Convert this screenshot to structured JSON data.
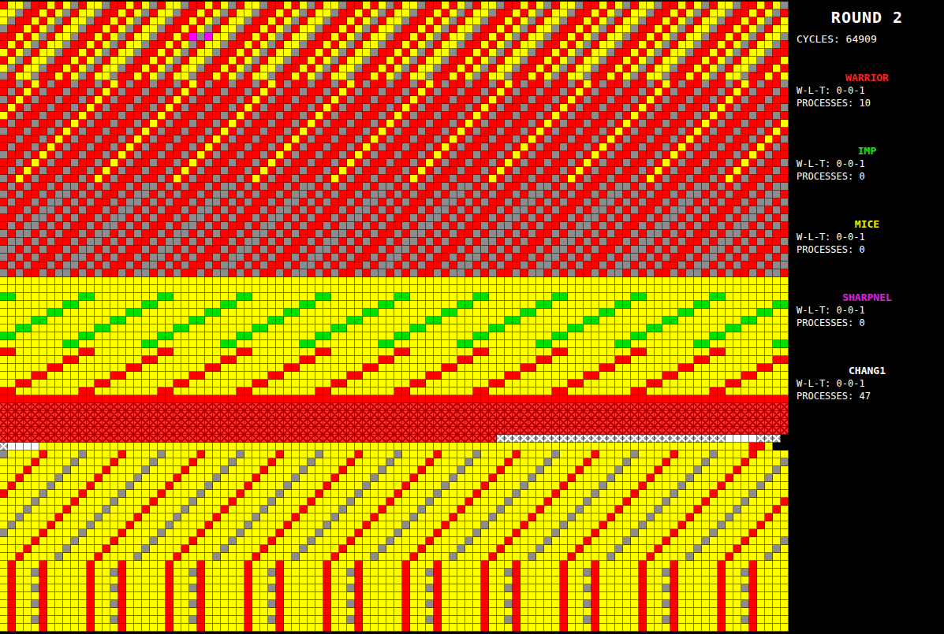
{
  "sidebar": {
    "round": "ROUND 2",
    "cycles": "CYCLES: 64909"
  },
  "warriors": [
    {
      "name": "WARRIOR",
      "record": "W-L-T: 0-0-1",
      "processes": "PROCESSES: 10",
      "color": "#ff2020"
    },
    {
      "name": "IMP",
      "record": "W-L-T: 0-0-1",
      "processes": "PROCESSES: 0",
      "color": "#20e020"
    },
    {
      "name": "MICE",
      "record": "W-L-T: 0-0-1",
      "processes": "PROCESSES: 0",
      "color": "#f0f000"
    },
    {
      "name": "SHARPNEL",
      "record": "W-L-T: 0-0-1",
      "processes": "PROCESSES: 0",
      "color": "#e020e0"
    },
    {
      "name": "CHANG1",
      "record": "W-L-T: 0-0-1",
      "processes": "PROCESSES: 47",
      "color": "#ffffff"
    }
  ],
  "core": {
    "rows": [
      "ryygrryrygryygrryrygryygrryrygryygrryrygryygrryrygryygrryrygryygrryrygryygrryrygryygrryrygryygrryryg",
      "yygrryrygryygrryrygryygrryrygryygrryrygryygrryrygryygrryrygryygrryrygryygrryrygryygrryrygryygrryrygr",
      "ygrryrygryygrryrygryygrryrygryygrryrygryygrryrygryygrryrygryygrryrygryygrryrygryygrryrygryygrryrygry",
      "grryrygryygrryrygryygrryrygryygrryrygryygrryrygryygrryrygryygrryrygryygrryrygryygrryrygryygrryrygryy",
      "rryrygryygrryrygryygrryrmgmyygrryrygryygrryrygryygrryrygryygrryrygryygrryrygryygrryrygryygrryrygryyg",
      "ryrygryygrryrygryygrryrygryygrryrygryygrryrygryygrryrygryygrryrygryygrryrygryygrryrygryygrryrygryygr",
      "yrygryygrryrygryygrryrygryygrryrygryygrryrygryygrryrygryygrryrygryygrryrygryygrryrygryygrryrygryygrr",
      "rygryygrryrygryygrryrygryygrryrygryygrryrygryygrryrygryygrryrygryygrryrygryygrryrygryygrryrygryygrry",
      "ygryygrryrygryygrryrygryygrryrygryygrryrygryygrryrygryygrryrygryygrryrygryygrryrygryygrryrygryygrryr",
      "gryygrryrygryygrryrygryygrryrygryygrryrygryygrryrygryygrryrygryygrryrygryygrryrygryygrryrygryygrryry",
      "rrgryrgrrgrrgryrgrrgrrgryrgrrgrrgryrgrrgrrgryrgrrgrrgryrgrrgrrgryrgrrgrrgryrgrrgrrgryrgrrgrrgryrgrrg",
      "rgryrgrrgrrgryrgrrgrrgryrgrrgrrgryrgrrgrrgryrgrrgrrgryrgrrgrrgryrgrrgrrgryrgrrgrrgryrgrrgrrgryrgrrgr",
      "gryrgrrgrrgryrgrrgrrgryrgrrgrrgryrgrrgrrgryrgrrgrrgryrgrrgrrgryrgrrgrrgryrgrrgrrgryrgrrgrrgryrgrrgrr",
      "ryrgrrgrrgryrgrrgrrgryrgrrgrrgryrgrrgrrgryrgrrgrrgryrgrrgrrgryrgrrgrrgryrgrrgrrgryrgrrgrrgryrgrrgrrg",
      "yrgrrgrrgryrgrrgrrgryrgrrgrrgryrgrrgrrgryrgrrgrrgryrgrrgrrgryrgrrgrrgryrgrrgrrgryrgrrgrrgryrgrrgrrgr",
      "rgrrgrrgryrgrrgrrgryrgrrgrrgryrgrrgrrgryrgrrgrrgryrgrrgrrgryrgrrgrrgryrgrrgrrgryrgrrgrrgryrgrrgrrgry",
      "grrgrrgryrgrrgrrgryrgrrgrrgryrgrrgrrgryrgrrgrrgryrgrrgrrgryrgrrgrrgryrgrrgrrgryrgrrgrrgryrgrrgrrgryr",
      "rrgrrgryrgrrgrrgryrgrrgrrgryrgrrgrrgryrgrrgrrgryrgrrgrrgryrgrrgrrgryrgrrgrrgryrgrrgrrgryrgrrgrrgryrg",
      "rgrrgryrgrrgrrgryrgrrgrrgryrgrrgrrgryrgrrgrrgryrgrrgrrgryrgrrgrrgryrgrrgrrgryrgrrgrrgryrgrrgrrgryrgr",
      "grrgryrgrrgrrgryrgrrgrrgryrgrrgrrgryrgrrgrrgryrgrrgrrgryrgrrgrrgryrgrrgrrgryrgrrgrrgryrgrrgrrgryrgrr",
      "rrgryrgrrgrrgryrgrrgrrgryrgrrgrrgryrgrrgrrgryrgrrgrrgryrgrrgrrgryrgrrgrrgryrgrrgrrgryrgrrgrrgryrgrrg",
      "rgryrgrrgrrgryrgrrgrrgryrgrrgrrgryrgrrgrrgryrgrrgrrgryrgrrgrrgryrgrrgrrgryrgrrgrrgryrgrrgrrgryrgrrgr",
      "gryrgrrgrrgryrgrrgrrgryrgrrgrrgryrgrrgrrgryrgrrgrrgryrgrrgrrgryrgrrgrrgryrgrrgrrgryrgrrgrrgryrgrrgrr",
      "rgrgrrgrggrgrgrrgrggrgrgrrgrggrgrgrrgrggrgrgrrgrggrgrgrrgrggrgrgrrgrggrgrgrrgrggrgrgrrgrggrgrgrrgrgg",
      "grgrrgrggrgrgrrgrggrgrgrrgrggrgrgrrgrggrgrgrrgrggrgrgrrgrggrgrgrrgrggrgrgrrgrggrgrgrrgrggrgrgrrgrggr",
      "rgrrgrggrgrgrrgrggrgrgrrgrggrgrgrrgrggrgrgrrgrggrgrgrrgrggrgrgrrgrggrgrgrrgrggrgrgrrgrggrgrgrrgrggrg",
      "grrgrggrgrgrrgrggrgrgrrgrggrgrgrrgrggrgrgrrgrggrgrgrrgrggrgrgrrgrggrgrgrrgrggrgrgrrgrggrgrgrrgrggrgr",
      "rrgrggrgrgrrgrggrgrgrrgrggrgrgrrgrggrgrgrrgrggrgrgrrgrggrgrgrrgrggrgrgrrgrggrgrgrrgrggrgrgrrgrggrgrg",
      "rgrggrgrgrrgrggrgrgrrgrggrgrgrrgrggrgrgrrgrggrgrgrrgrggrgrgrrgrggrgrgrrgrggrgrgrrgrggrgrgrrgrggrgrgr",
      "grggrgrgrrgrggrgrgrrgrggrgrgrrgrggrgrgrrgrggrgrgrrgrggrgrgrrgrggrgrgrrgrggrgrgrrgrggrgrgrrgrggrgrgrr",
      "rggrgrgrrgrggrgrgrrgrggrgrgrrgrggrgrgrrgrggrgrgrrgrggrgrgrrgrggrgrgrrgrggrgrgrrgrggrgrgrrgrggrgrgrrg",
      "ggrgrgrrgrggrgrgrrgrggrgrgrrgrggrgrgrrgrggrgrgrrgrggrgrgrrgrggrgrgrrgrggrgrgrrgrggrgrgrrgrggrgrgrrgr",
      "grgrgrrgrggrgrgrrgrggrgrgrrgrggrgrgrrgrggrgrgrrgrggrgrgrrgrggrgrgrrgrggrgrgrrgrggrgrgrrgrggrgrgrrgrg",
      "rgrgrrgrggrgrgrrgrggrgrgrrgrggrgrgrrgrggrgrgrrgrggrgrgrrgrggrgrgrrgrggrgrgrrgrggrgrgrrgrggrgrgrrgrgg",
      "grgrrgrggrgrgrrgrggrgrgrrgrggrgrgrrgrggrgrgrrgrggrgrgrrgrggrgrgrrgrggrgrgrrgrggrgrgrrgrggrgrgrrgrggr",
      "yyyyyyyyyyyyyyyyyyyyyyyyyyyyyyyyyyyyyyyyyyyyyyyyyyyyyyyyyyyyyyyyyyyyyyyyyyyyyyyyyyyyyyyyyyyyyyyyyyyy",
      "yyyyyyyyyyyyyyyyyyyyyyyyyyyyyyyyyyyyyyyyyyyyyyyyyyyyyyyyyyyyyyyyyyyyyyyyyyyyyyyyyyyyyyyyyyyyyyyyyyyy",
      "GGyyyyyyyyGGyyyyyyyyGGyyyyyyyyGGyyyyyyyyGGyyyyyyyyGGyyyyyyyyGGyyyyyyyyGGyyyyyyyyGGyyyyyyyyGGyyyyyyyy",
      "yyyyyyyyGGyyyyyyyyGGyyyyyyyyGGyyyyyyyyGGyyyyyyyyGGyyyyyyyyGGyyyyyyyyGGyyyyyyyyGGyyyyyyyyGGyyyyyyyyGG",
      "yyyyyyGGyyyyyyyyGGyyyyyyyyGGyyyyyyyyGGyyyyyyyyGGyyyyyyyyGGyyyyyyyyGGyyyyyyyyGGyyyyyyyyGGyyyyyyyyGGyy",
      "yyyyGGyyyyyyyyGGyyyyyyyyGGyyyyyyyyGGyyyyyyyyGGyyyyyyyyGGyyyyyyyyGGyyyyyyyyGGyyyyyyyyGGyyyyyyyyGGyyyy",
      "yyGGyyyyyyyyGGyyyyyyyyGGyyyyyyyyGGyyyyyyyyGGyyyyyyyyGGyyyyyyyyGGyyyyyyyyGGyyyyyyyyGGyyyyyyyyGGyyyyyy",
      "GGyyyyyyyyGGyyyyyyyyGGyyyyyyyyGGyyyyyyyyGGyyyyyyyyGGyyyyyyyyGGyyyyyyyyGGyyyyyyyyGGyyyyyyyyGGyyyyyyyy",
      "yyyyyyyyGGyyyyyyyyGGyyyyyyyyGGyyyyyyyyGGyyyyyyyyGGyyyyyyyyGGyyyyyyyyGGyyyyyyyyGGyyyyyyyyGGyyyyyyyyGG",
      "rryyyyyyyyrryyyyyyyyrryyyyyyyyrryyyyyyyyrryyyyyyyyrryyyyyyyyrryyyyyyyyrryyyyyyyyrryyyyyyyyrryyyyyyyy",
      "yyyyyyyyrryyyyyyyyrryyyyyyyyrryyyyyyyyrryyyyyyyyrryyyyyyyyrryyyyyyyyrryyyyyyyyrryyyyyyyyrryyyyyyyyrr",
      "yyyyyyrryyyyyyyyrryyyyyyyyrryyyyyyyyrryyyyyyyyrryyyyyyyyrryyyyyyyyrryyyyyyyyrryyyyyyyyrryyyyyyyyrryy",
      "yyyyrryyyyyyyyrryyyyyyyyrryyyyyyyyrryyyyyyyyrryyyyyyyyrryyyyyyyyrryyyyyyyyrryyyyyyyyrryyyyyyyyrryyyy",
      "yyrryyyyyyyyrryyyyyyyyrryyyyyyyyrryyyyyyyyrryyyyyyyyrryyyyyyyyrryyyyyyyyrryyyyyyyyrryyyyyyyyrryyyyyy",
      "rryyyyyyyyrryyyyyyyyrryyyyyyyyrryyyyyyyyrryyyyyyyyrryyyyyyyyrryyyyyyyyrryyyyyyyyrryyyyyyyyrryyyyyyyy",
      "rrrrrrrrrrrrrrrrrrrrrrrrrrrrrrrrrrrrrrrrrrrrrrrrrrrrrrrrrrrrrrrrrrrrrrrrrrrrrrrrrrrrrrrrrrrrrrrrrrrr",
      "xxxxxxxxxxxxxxxxxxxxxxxxxxxxxxxxxxxxxxxxxxxxxxxxxxxxxxxxxxxxxxxxxxxxxxxxxxxxxxxxxxxxxxxxxxxxxxxxxxxx",
      "xxxxxxxxxxxxxxxxxxxxxxxxxxxxxxxxxxxxxxxxxxxxxxxxxxxxxxxxxxxxxxxxxxxxxxxxxxxxxxxxxxxxxxxxxxxxxxxxxxxx",
      "xxxxxxxxxxxxxxxxxxxxxxxxxxxxxxxxxxxxxxxxxxxxxxxxxxxxxxxxxxxxxxxxxxxxxxxxxxxxxxxxxxxxxxxxxxxxxxxxxxxx",
      "xxxxxxxxxxxxxxxxxxxxxxxxxxxxxxxxxxxxxxxxxxxxxxxxxxxxxxxxxxxxxxxxxxxxxxxxxxxxxxxxxxxxxxxxxxxxxxxxxxxx",
      "xxxxxxxxxxxxxxxxxxxxxxxxxxxxxxxxxxxxxxxxxxxxxxxxxxxxxxxxxxxxxxxwwwwwwwwwwwwwwwwwwwwwwwwwwwwwWWWWwww",
      "wWWWWyyyyyyyyyyyyyyyyyyyyyyyyyyyyyyyyyyyyyyyyyyyyyyyyyyyyyyyyyyyyyyyyyyyyyyyyyyyyyyyyyyyyyyyyyyrry",
      "gyyyyryyyygyyyyryyyygyyyyryyyygyyyyryyyygyyyyryyyygyyyyryyyygyyyyryyyygyyyyryyyygyyyyryyyygyyyyryyyy",
      "yyyyryyyygyyyyryyyygyyyyryyyygyyyyryyyygyyyyryyyygyyyyryyyygyyyyryyyygyyyyryyyygyyyyryyyygyyyyryyyyg",
      "yyyryyyygyyyyryyyygyyyyryyyygyyyyryyyygyyyyryyyygyyyyryyyygyyyyryyyygyyyyryyyygyyyyryyyygyyyyryyyygy",
      "yyryyyygyyyyryyyygyyyyryyyygyyyyryyyygyyyyryyyygyyyyryyyygyyyyryyyygyyyyryyyygyyyyryyyygyyyyryyyygyy",
      "yryyyygyyyyryyyygyyyyryyyygyyyyryyyygyyyyryyyygyyyyryyyygyyyyryyyygyyyyryyyygyyyyryyyygyyyyryyyygyyy",
      "ryyyygyyyyryyyygyyyyryyyygyyyyryyyygyyyyryyyygyyyyryyyygyyyyryyyygyyyyryyyygyyyyryyyygyyyyryyyygyyyy",
      "yyyygyyyyryyyygyyyyryyyygyyyyryyyygyyyyryyyygyyyyryyyygyyyyryyyygyyyyryyyygyyyyryyyygyyyyryyyygyyyyr",
      "yyygyyyyryyyygyyyyryyyygyyyyryyyygyyyyryyyygyyyyryyyygyyyyryyyygyyyyryyyygyyyyryyyygyyyyryyyygyyyyry",
      "yygyyyyryyyygyyyyryyyygyyyyryyyygyyyyryyyygyyyyryyyygyyyyryyyygyyyyryyyygyyyyryyyygyyyyryyyygyyyyryy",
      "ygyyyyryyyygyyyyryyyygyyyyryyyygyyyyryyyygyyyyryyyygyyyyryyyygyyyyryyyygyyyyryyyygyyyyryyyygyyyyryyy",
      "gyyyyryyyygyyyyryyyygyyyyryyyygyyyyryyyygyyyyryyyygyyyyryyyygyyyyryyyygyyyyryyyygyyyyryyyygyyyyryyyy",
      "yyyyryyyygyyyyryyyygyyyyryyyygyyyyryyyygyyyyryyyygyyyyryyyygyyyyryyyygyyyyryyyygyyyyryyyygyyyyryyyyg",
      "yyyryyyygyyyyryyyygyyyyryyyygyyyyryyyygyyyyryyyygyyyyryyyygyyyyryyyygyyyyryyyygyyyyryyyygyyyyryyyygy",
      "yyryyyygyyyyryyyygyyyyryyyygyyyyryyyygyyyyryyyygyyyyryyyygyyyyryyyygyyyyryyyygyyyyryyyygyyyyryyyygyy",
      "yryyyryyyyyryyyryyyyyryyyryyyyyryyyryyyyyryyyryyyyyryyyryyyyyryyyryyyyyryyyryyyyyryyyryyyyyryyyryyyy",
      "yryygryyyyyryygryyyyyryygryyyyyryygryyyyyryygryyyyyryygryyyyyryygryyyyyryygryyyyyryygryyyyyryygryyyy",
      "yryyyryyyyyryyyryyyyyryyyryyyyyryyyryyyyyryyyryyyyyryyyryyyyyryyyryyyyyryyyryyyyyryyyryyyyyryyyryyyy",
      "yryygryyyyyryygryyyyyryygryyyyyryygryyyyyryygryyyyyryygryyyyyryygryyyyyryygryyyyyryygryyyyyryygryyyy",
      "yryyyryyyyyryyyryyyyyryyyryyyyyryyyryyyyyryyyryyyyyryyyryyyyyryyyryyyyyryyyryyyyyryyyryyyyyryyyryyyy",
      "yryygryyyyyryygryyyyyryygryyyyyryygryyyyyryygryyyyyryygryyyyyryygryyyyyryygryyyyyryygryyyyyryygryyyy",
      "yryyyryyyyyryyyryyyyyryyyryyyyyryyyryyyyyryyyryyyyyryyyryyyyyryyyryyyyyryyyryyyyyryyyryyyyyryyyryyyy",
      "yryygryyyyyryygryyyyyryygryyyyyryygryyyyyryygryyyyyryygryyyyyryygryyyyyryygryyyyyryygryyyyyryygryyyy",
      "yryyyryyyyyryyyryyyyyryyyryyyyyryyyryyyyyryyyryyyyyryyyryyyyyryyyryyyyyryyyryyyyyryyyryyyyyryyyryyyy"
    ]
  }
}
